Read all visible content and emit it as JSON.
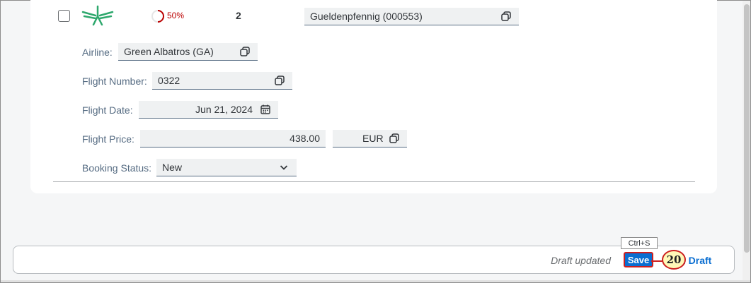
{
  "item": {
    "progress_text": "50%",
    "progress_fraction": 0.5,
    "count": "2",
    "customer": "Gueldenpfennig (000553)"
  },
  "form": {
    "airline_label": "Airline:",
    "airline_value": "Green Albatros (GA)",
    "flight_number_label": "Flight Number:",
    "flight_number_value": "0322",
    "flight_date_label": "Flight Date:",
    "flight_date_value": "Jun 21, 2024",
    "flight_price_label": "Flight Price:",
    "flight_price_value": "438.00",
    "currency_value": "EUR",
    "booking_status_label": "Booking Status:",
    "booking_status_value": "New"
  },
  "footer": {
    "draft_status": "Draft updated",
    "save_label": "Save",
    "discard_label": "ard Draft",
    "shortcut_tooltip": "Ctrl+S"
  },
  "annotation": {
    "step": "20"
  },
  "colors": {
    "accent": "#0a6ed1",
    "error": "#bb0000",
    "highlight": "#cc1f1f",
    "logo": "#2ea86d"
  },
  "icons": [
    "copy-icon",
    "calendar-icon",
    "chevron-down-icon",
    "airline-logo-icon"
  ]
}
